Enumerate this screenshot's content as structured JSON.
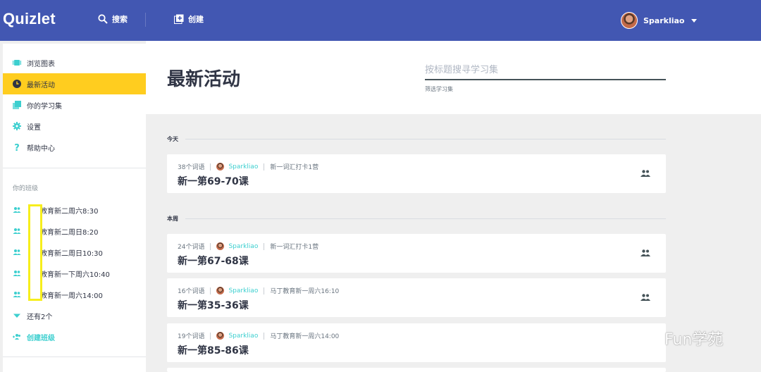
{
  "header": {
    "logo": "Quizlet",
    "search_label": "搜索",
    "create_label": "创建",
    "username": "Sparkliao"
  },
  "sidebar": {
    "items": [
      {
        "label": "浏览图表",
        "icon": "cards-icon"
      },
      {
        "label": "最新活动",
        "icon": "clock-icon"
      },
      {
        "label": "你的学习集",
        "icon": "sets-icon"
      },
      {
        "label": "设置",
        "icon": "gear-icon"
      },
      {
        "label": "帮助中心",
        "icon": "help-icon"
      }
    ],
    "classes_label": "你的班级",
    "classes": [
      "教育新二周六8:30",
      "教育新二周日8:20",
      "教育新二周日10:30",
      "教育新一下周六10:40",
      "教育新一周六14:00"
    ],
    "more_label": "还有2个",
    "create_class_label": "创建班级"
  },
  "main": {
    "title": "最新活动",
    "search_placeholder": "按标题搜寻学习集",
    "filter_label": "筛选学习集",
    "groups": [
      {
        "label": "今天",
        "cards": [
          {
            "terms": "38个词语",
            "author": "Sparkliao",
            "class": "新一词汇打卡1营",
            "title": "新一第69-70课"
          }
        ]
      },
      {
        "label": "本周",
        "cards": [
          {
            "terms": "24个词语",
            "author": "Sparkliao",
            "class": "新一词汇打卡1营",
            "title": "新一第67-68课"
          },
          {
            "terms": "16个词语",
            "author": "Sparkliao",
            "class": "马丁教育新一周六16:10",
            "title": "新一第35-36课"
          },
          {
            "terms": "19个词语",
            "author": "Sparkliao",
            "class": "马丁教育新一周六14:00",
            "title": "新一第85-86课"
          }
        ]
      }
    ]
  },
  "watermark": "Fun学苑",
  "colors": {
    "header_bg": "#4257b2",
    "active_bg": "#ffcd1f",
    "accent": "#3ccfcf",
    "highlight": "#f7ee1c"
  }
}
